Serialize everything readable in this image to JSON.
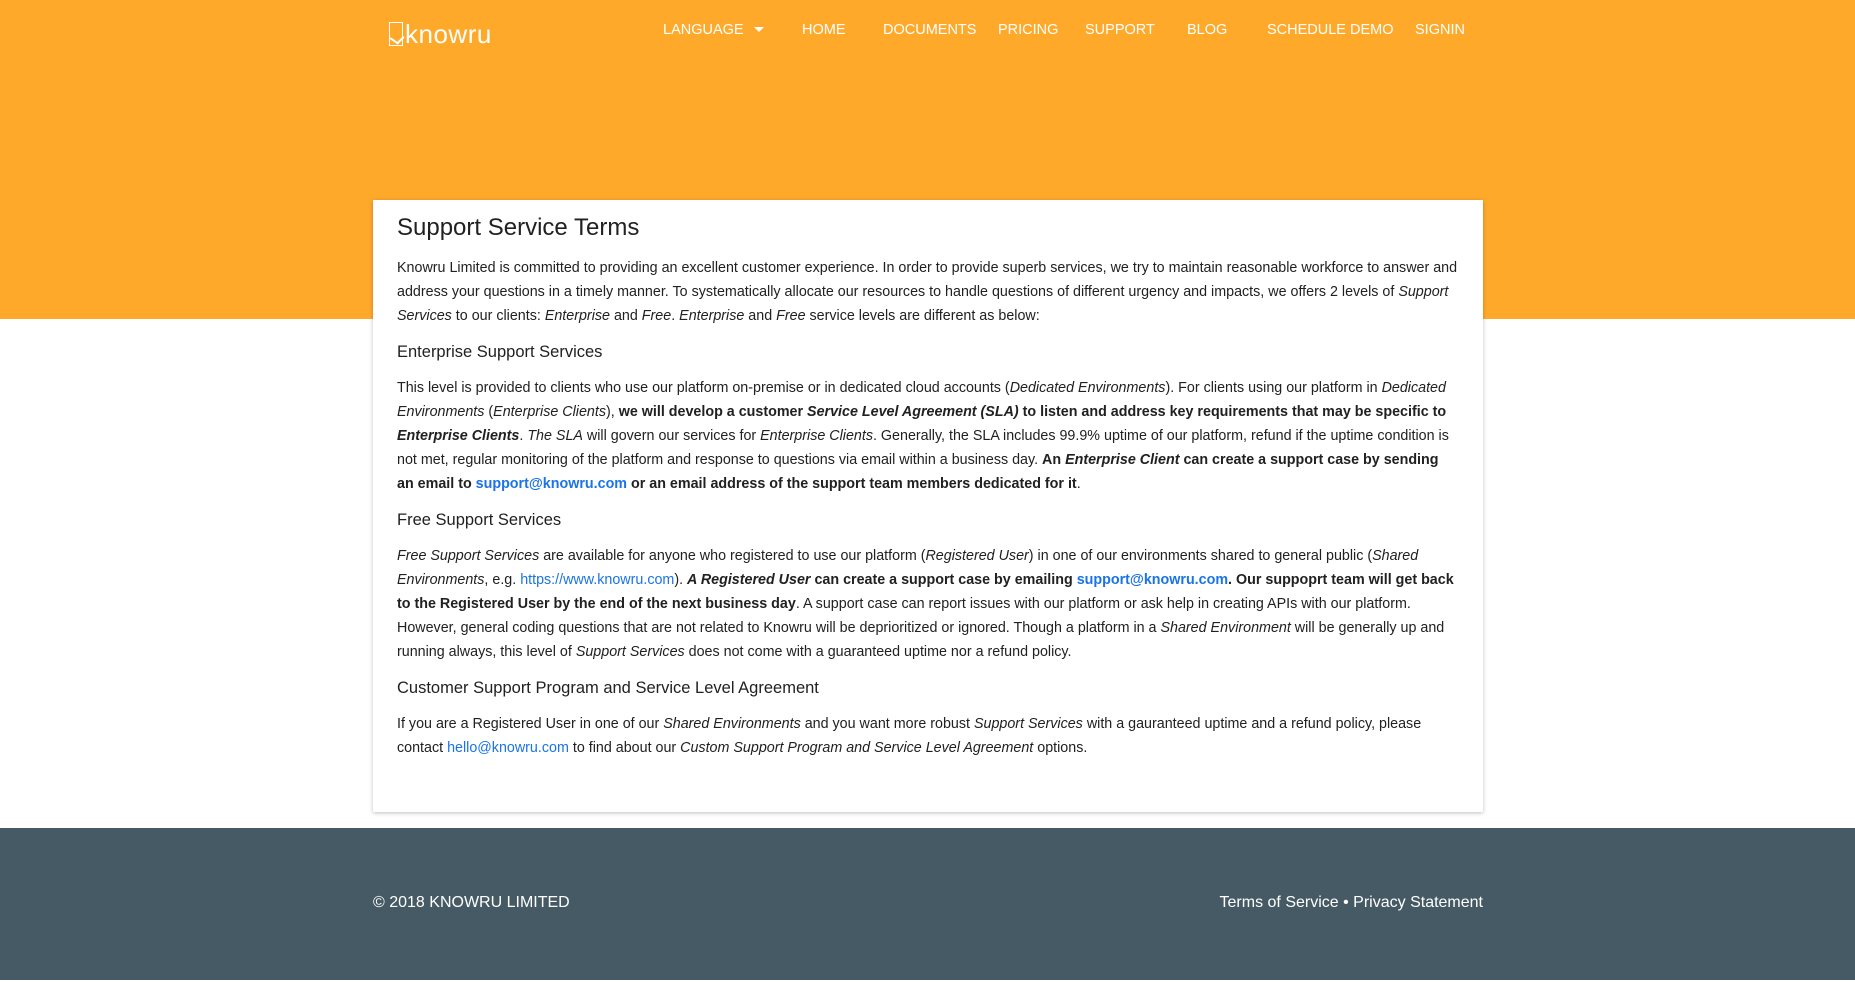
{
  "brand": {
    "name": "knowru"
  },
  "nav": {
    "language": "LANGUAGE",
    "home": "HOME",
    "documents": "DOCUMENTS",
    "pricing": "PRICING",
    "support": "SUPPORT",
    "blog": "BLOG",
    "schedule_demo": "SCHEDULE DEMO",
    "signin": "SIGNIN"
  },
  "content": {
    "title": "Support Service Terms",
    "intro": {
      "t1": "Knowru Limited is committed to providing an excellent customer experience. In order to provide superb services, we try to maintain reasonable workforce to answer and address your questions in a timely manner. To systematically allocate our resources to handle questions of different urgency and impacts, we offers 2 levels of ",
      "i1": "Support Services",
      "t2": " to our clients: ",
      "i2": "Enterprise",
      "t3": " and ",
      "i3": "Free",
      "t4": ". ",
      "i4": "Enterprise",
      "t5": " and ",
      "i5": "Free",
      "t6": " service levels are different as below:"
    },
    "enterprise": {
      "heading": "Enterprise Support Services",
      "t1": "This level is provided to clients who use our platform on-premise or in dedicated cloud accounts (",
      "i1": "Dedicated Environments",
      "t2": "). For clients using our platform in ",
      "i2": "Dedicated Environments",
      "t3": " (",
      "i3": "Enterprise Clients",
      "t4": "), ",
      "b1": "we will develop a customer ",
      "bi1": "Service Level Agreement (SLA)",
      "b2": " to listen and address key requirements that may be specific to ",
      "bi2": "Enterprise Clients",
      "t5": ". ",
      "i4": "The SLA",
      "t6": " will govern our services for ",
      "i5": "Enterprise Clients",
      "t7": ". Generally, the SLA includes 99.9% uptime of our platform, refund if the uptime condition is not met, regular monitoring of the platform and response to questions via email within a business day. ",
      "b3": "An ",
      "bi3": "Enterprise Client",
      "b4": " can create a support case by sending an email to ",
      "link": "support@knowru.com",
      "b5": " or an email address of the support team members dedicated for it",
      "t8": "."
    },
    "free": {
      "heading": "Free Support Services",
      "i1": "Free Support Services",
      "t1": " are available for anyone who registered to use our platform (",
      "i2": "Registered User",
      "t2": ") in one of our environments shared to general public (",
      "i3": "Shared Environments",
      "t3": ", e.g. ",
      "link1": "https://www.knowru.com",
      "t4": "). ",
      "bi1": "A Registered User",
      "b1": " can create a support case by emailing ",
      "link2": "support@knowru.com",
      "b2": ". Our suppoprt team will get back to the Registered User by the end of the next business day",
      "t5": ". A support case can report issues with our platform or ask help in creating APIs with our platform. However, general coding questions that are not related to Knowru will be deprioritized or ignored. Though a platform in a ",
      "i4": "Shared Environment",
      "t6": " will be generally up and running always, this level of ",
      "i5": "Support Services",
      "t7": " does not come with a guaranteed uptime nor a refund policy."
    },
    "program": {
      "heading": "Customer Support Program and Service Level Agreement",
      "t1": "If you are a Registered User in one of our ",
      "i1": "Shared Environments",
      "t2": " and you want more robust ",
      "i2": "Support Services",
      "t3": " with a gauranteed uptime and a refund policy, please contact ",
      "link": "hello@knowru.com",
      "t4": " to find about our ",
      "i3": "Custom Support Program and Service Level Agreement",
      "t5": " options."
    }
  },
  "footer": {
    "copyright": "© 2018 KNOWRU LIMITED",
    "terms": "Terms of Service",
    "separator": " • ",
    "privacy": "Privacy Statement"
  },
  "colors": {
    "hero": "#ffa92b",
    "footer": "#455a64",
    "link": "#1a73e8"
  }
}
